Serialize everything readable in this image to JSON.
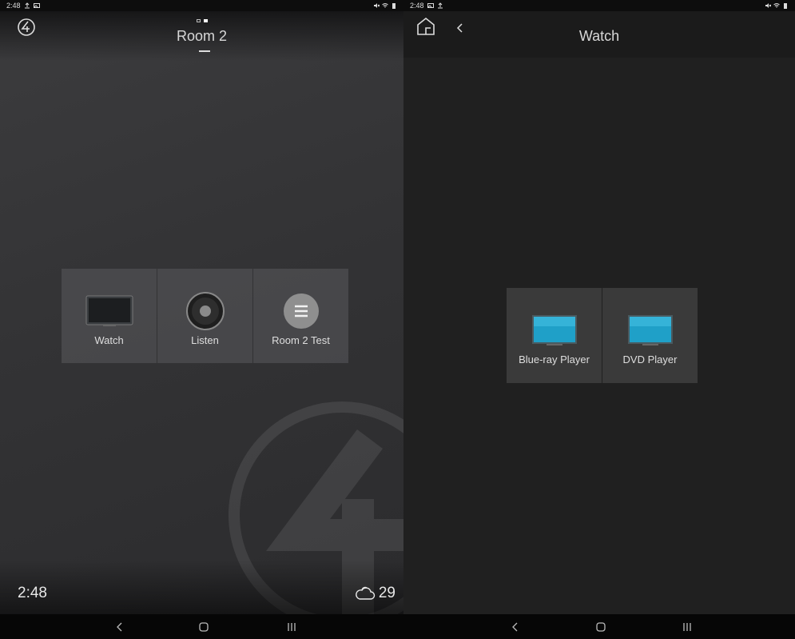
{
  "left": {
    "status": {
      "time": "2:48"
    },
    "title": "Room 2",
    "tiles": [
      {
        "label": "Watch",
        "icon": "tv-icon"
      },
      {
        "label": "Listen",
        "icon": "speaker-icon"
      },
      {
        "label": "Room 2 Test",
        "icon": "menu-circle-icon"
      }
    ],
    "clock": "2:48",
    "weather": {
      "temp": "29",
      "icon": "cloud-icon"
    }
  },
  "right": {
    "status": {
      "time": "2:48"
    },
    "title": "Watch",
    "tiles": [
      {
        "label": "Blue-ray Player",
        "icon": "tv-blue-icon"
      },
      {
        "label": "DVD Player",
        "icon": "tv-blue-icon"
      }
    ]
  },
  "colors": {
    "tile_tv_blue": "#1fa0c8",
    "left_bg": "#333335",
    "right_bg": "#202020"
  }
}
